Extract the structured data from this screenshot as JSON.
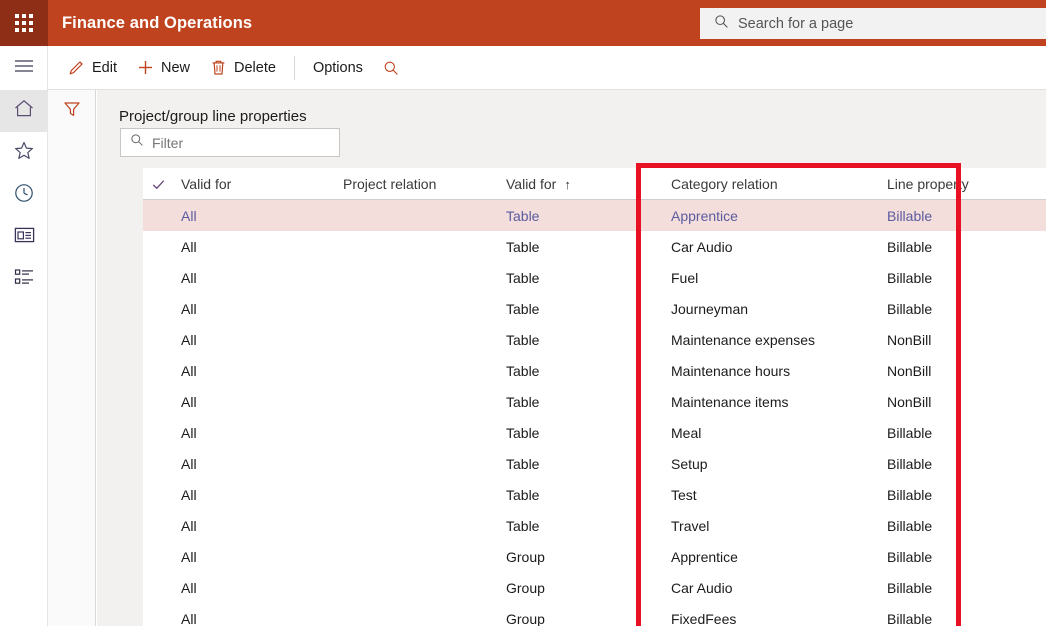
{
  "topbar": {
    "waffle_icon": "waffle-grid-icon",
    "app_title": "Finance and Operations",
    "search": {
      "icon": "search-icon",
      "placeholder": "Search for a page",
      "value": ""
    }
  },
  "rail": {
    "items": [
      {
        "icon": "hamburger-icon",
        "name": "navigation-menu"
      },
      {
        "icon": "home-icon",
        "name": "home"
      },
      {
        "icon": "star-icon",
        "name": "favorites"
      },
      {
        "icon": "clock-icon",
        "name": "recents"
      },
      {
        "icon": "workspace-icon",
        "name": "workspaces"
      },
      {
        "icon": "modules-icon",
        "name": "modules"
      }
    ]
  },
  "commandbar": {
    "edit": "Edit",
    "new": "New",
    "delete": "Delete",
    "options": "Options",
    "search_icon": "search-icon"
  },
  "filterpane": {
    "filter_icon": "filter-icon"
  },
  "page": {
    "title": "Project/group line properties",
    "filter": {
      "icon": "search-icon",
      "placeholder": "Filter",
      "value": ""
    }
  },
  "grid": {
    "columns": [
      {
        "key": "valid_for_1",
        "label": "Valid for",
        "sorted": false
      },
      {
        "key": "project_relation",
        "label": "Project relation",
        "sorted": false
      },
      {
        "key": "valid_for_2",
        "label": "Valid for",
        "sorted": true,
        "sort_arrow": "↑"
      },
      {
        "key": "category_relation",
        "label": "Category relation",
        "sorted": false
      },
      {
        "key": "line_property",
        "label": "Line property",
        "sorted": false
      }
    ],
    "select_all_icon": "checkmark-icon",
    "rows": [
      {
        "valid_for_1": "All",
        "project_relation": "",
        "valid_for_2": "Table",
        "category_relation": "Apprentice",
        "line_property": "Billable",
        "selected": true
      },
      {
        "valid_for_1": "All",
        "project_relation": "",
        "valid_for_2": "Table",
        "category_relation": "Car Audio",
        "line_property": "Billable",
        "selected": false
      },
      {
        "valid_for_1": "All",
        "project_relation": "",
        "valid_for_2": "Table",
        "category_relation": "Fuel",
        "line_property": "Billable",
        "selected": false
      },
      {
        "valid_for_1": "All",
        "project_relation": "",
        "valid_for_2": "Table",
        "category_relation": "Journeyman",
        "line_property": "Billable",
        "selected": false
      },
      {
        "valid_for_1": "All",
        "project_relation": "",
        "valid_for_2": "Table",
        "category_relation": "Maintenance expenses",
        "line_property": "NonBill",
        "selected": false
      },
      {
        "valid_for_1": "All",
        "project_relation": "",
        "valid_for_2": "Table",
        "category_relation": "Maintenance hours",
        "line_property": "NonBill",
        "selected": false
      },
      {
        "valid_for_1": "All",
        "project_relation": "",
        "valid_for_2": "Table",
        "category_relation": "Maintenance items",
        "line_property": "NonBill",
        "selected": false
      },
      {
        "valid_for_1": "All",
        "project_relation": "",
        "valid_for_2": "Table",
        "category_relation": "Meal",
        "line_property": "Billable",
        "selected": false
      },
      {
        "valid_for_1": "All",
        "project_relation": "",
        "valid_for_2": "Table",
        "category_relation": "Setup",
        "line_property": "Billable",
        "selected": false
      },
      {
        "valid_for_1": "All",
        "project_relation": "",
        "valid_for_2": "Table",
        "category_relation": "Test",
        "line_property": "Billable",
        "selected": false
      },
      {
        "valid_for_1": "All",
        "project_relation": "",
        "valid_for_2": "Table",
        "category_relation": "Travel",
        "line_property": "Billable",
        "selected": false
      },
      {
        "valid_for_1": "All",
        "project_relation": "",
        "valid_for_2": "Group",
        "category_relation": "Apprentice",
        "line_property": "Billable",
        "selected": false
      },
      {
        "valid_for_1": "All",
        "project_relation": "",
        "valid_for_2": "Group",
        "category_relation": "Car Audio",
        "line_property": "Billable",
        "selected": false
      },
      {
        "valid_for_1": "All",
        "project_relation": "",
        "valid_for_2": "Group",
        "category_relation": "FixedFees",
        "line_property": "Billable",
        "selected": false
      }
    ]
  },
  "annotation": {
    "shape": "red-rectangle-highlight",
    "color": "#e81123",
    "targets": [
      "Category relation",
      "Line property"
    ]
  },
  "colors": {
    "brand": "#c0431f",
    "brand_dark": "#8e2e17",
    "selected_row": "#f4dedb",
    "selected_text": "#5b5ba0",
    "annotation": "#e81123"
  }
}
